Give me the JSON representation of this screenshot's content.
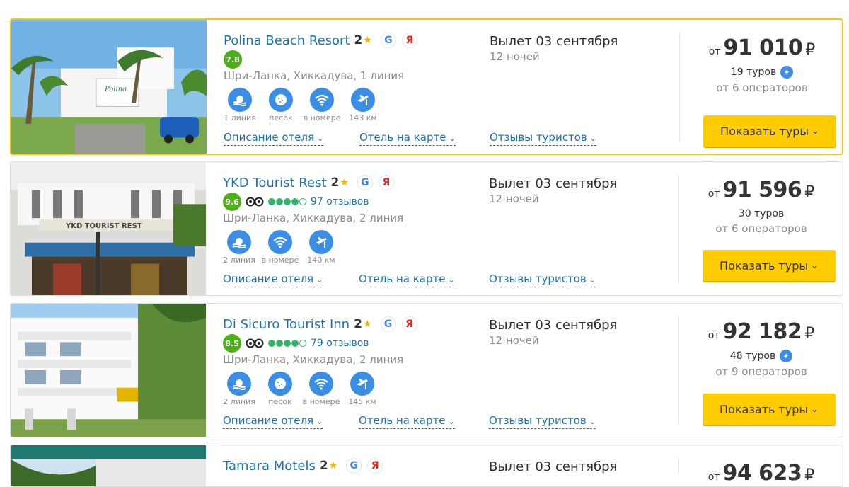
{
  "hotels": [
    {
      "name": "Polina Beach Resort",
      "stars": "2",
      "rating": "7.8",
      "reviews": "",
      "location": "Шри-Ланка, Хиккадува, 1 линия",
      "features": [
        {
          "icon": "beach-icon",
          "label": "1 линия"
        },
        {
          "icon": "sand-icon",
          "label": "песок"
        },
        {
          "icon": "wifi-icon",
          "label": "в номере"
        },
        {
          "icon": "airport-icon",
          "label": "143 км"
        }
      ],
      "links": {
        "description": "Описание отеля",
        "map": "Отель на карте",
        "reviews": "Отзывы туристов"
      },
      "flight": "Вылет 03 сентября",
      "nights": "12 ночей",
      "price_from": "от",
      "price": "91 010",
      "currency": "₽",
      "tours": "19 туров",
      "operators": "от 6 операторов",
      "button": "Показать туры"
    },
    {
      "name": "YKD Tourist Rest",
      "stars": "2",
      "rating": "9.6",
      "reviews": "97 отзывов",
      "location": "Шри-Ланка, Хиккадува, 2 линия",
      "features": [
        {
          "icon": "beach-icon",
          "label": "2 линия"
        },
        {
          "icon": "wifi-icon",
          "label": "в номере"
        },
        {
          "icon": "airport-icon",
          "label": "140 км"
        }
      ],
      "links": {
        "description": "Описание отеля",
        "map": "Отель на карте",
        "reviews": "Отзывы туристов"
      },
      "flight": "Вылет 03 сентября",
      "nights": "12 ночей",
      "price_from": "от",
      "price": "91 596",
      "currency": "₽",
      "tours": "30 туров",
      "operators": "от 6 операторов",
      "button": "Показать туры"
    },
    {
      "name": "Di Sicuro Tourist Inn",
      "stars": "2",
      "rating": "8.5",
      "reviews": "79 отзывов",
      "location": "Шри-Ланка, Хиккадува, 2 линия",
      "features": [
        {
          "icon": "beach-icon",
          "label": "2 линия"
        },
        {
          "icon": "sand-icon",
          "label": "песок"
        },
        {
          "icon": "wifi-icon",
          "label": "в номере"
        },
        {
          "icon": "airport-icon",
          "label": "145 км"
        }
      ],
      "links": {
        "description": "Описание отеля",
        "map": "Отель на карте",
        "reviews": "Отзывы туристов"
      },
      "flight": "Вылет 03 сентября",
      "nights": "12 ночей",
      "price_from": "от",
      "price": "92 182",
      "currency": "₽",
      "tours": "48 туров",
      "operators": "от 9 операторов",
      "button": "Показать туры"
    },
    {
      "name": "Tamara Motels",
      "stars": "2",
      "flight": "Вылет 03 сентября",
      "price_from": "от",
      "price": "94 623",
      "currency": "₽"
    }
  ],
  "colors": {
    "accent_blue": "#1a73b8",
    "button_yellow": "#ffcc00",
    "rating_green": "#4caf1a",
    "selected_border": "#f5c518"
  }
}
